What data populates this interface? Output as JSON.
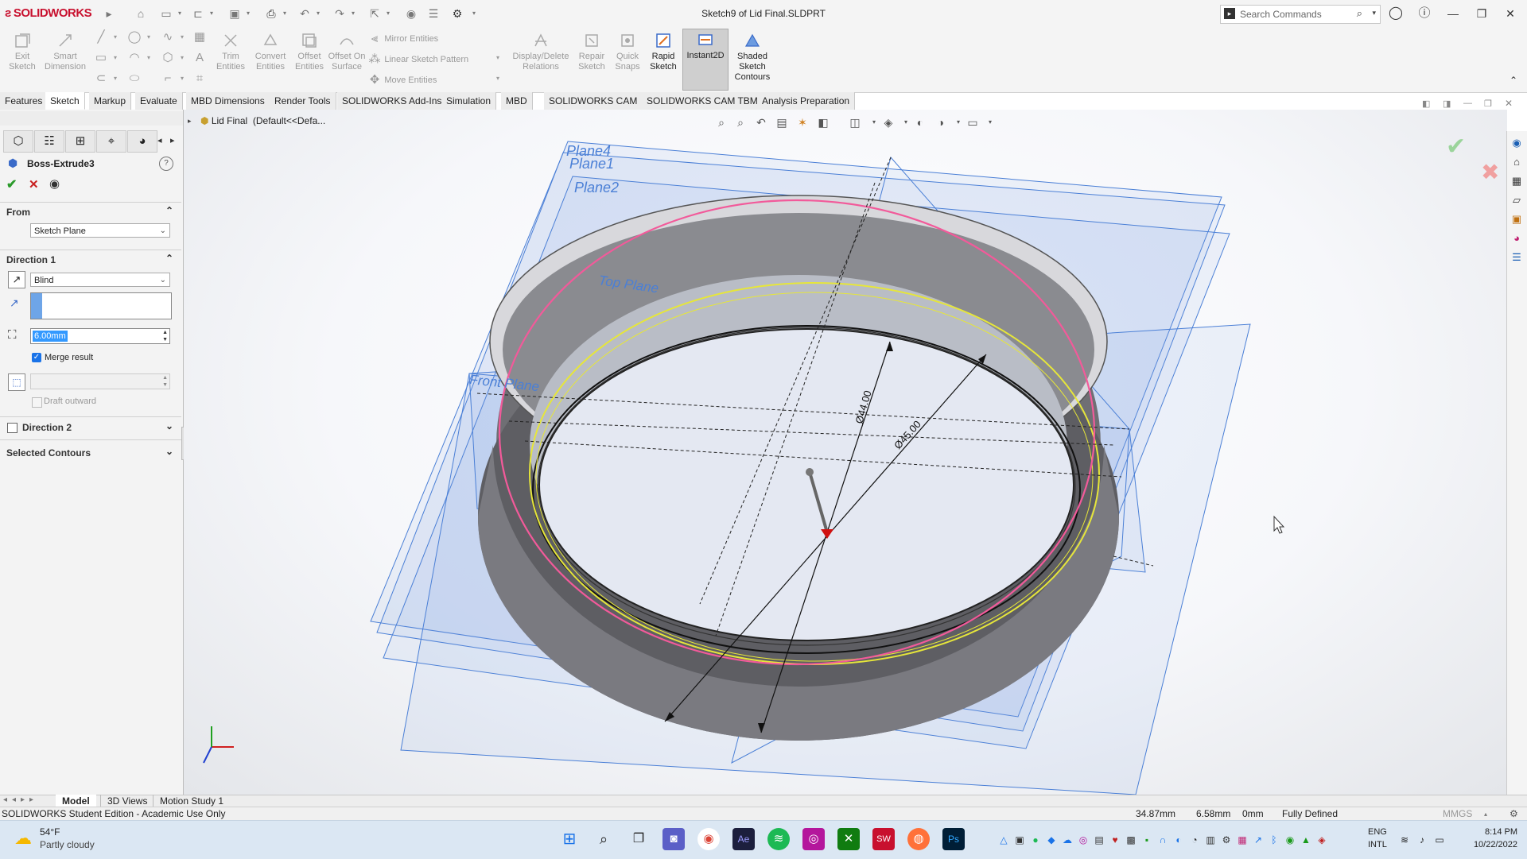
{
  "app": {
    "brand": "SOLIDWORKS",
    "document_title": "Sketch9 of Lid Final.SLDPRT"
  },
  "search": {
    "placeholder": "Search Commands"
  },
  "commands": {
    "exit_sketch": "Exit Sketch",
    "smart_dimension": "Smart Dimension",
    "trim_entities": "Trim Entities",
    "convert_entities": "Convert Entities",
    "offset_entities": "Offset Entities",
    "offset_on_surface": "Offset On Surface",
    "mirror_entities": "Mirror Entities",
    "linear_sketch_pattern": "Linear Sketch Pattern",
    "move_entities": "Move Entities",
    "display_delete_relations": "Display/Delete Relations",
    "repair_sketch": "Repair Sketch",
    "quick_snaps": "Quick Snaps",
    "rapid_sketch": "Rapid Sketch",
    "instant2d": "Instant2D",
    "shaded_sketch_contours": "Shaded Sketch Contours"
  },
  "tabs": [
    "Features",
    "Sketch",
    "Markup",
    "Evaluate",
    "MBD Dimensions",
    "Render Tools",
    "SOLIDWORKS Add-Ins",
    "Simulation",
    "MBD",
    "SOLIDWORKS CAM",
    "SOLIDWORKS CAM TBM",
    "Analysis Preparation"
  ],
  "active_tab": "Sketch",
  "feature_tree": {
    "part": "Lid Final",
    "config": "(Default<<Defa..."
  },
  "property_manager": {
    "feature_title": "Boss-Extrude3",
    "from": {
      "heading": "From",
      "value": "Sketch Plane"
    },
    "direction1": {
      "heading": "Direction 1",
      "end_condition": "Blind",
      "depth": "6.00mm",
      "merge_result_label": "Merge result",
      "merge_result_checked": true,
      "draft_outward_label": "Draft outward"
    },
    "direction2": {
      "heading": "Direction 2"
    },
    "selected_contours": {
      "heading": "Selected Contours"
    }
  },
  "viewport": {
    "planes": [
      "Plane4",
      "Plane1",
      "Plane2",
      "Top Plane",
      "Front Plane"
    ],
    "dimensions": [
      "Ø44.00",
      "Ø45.00"
    ]
  },
  "bottom_tabs": [
    "Model",
    "3D Views",
    "Motion Study 1"
  ],
  "active_bottom_tab": "Model",
  "status": {
    "edition": "SOLIDWORKS Student Edition - Academic Use Only",
    "x": "34.87mm",
    "y": "6.58mm",
    "z": "0mm",
    "state": "Fully Defined",
    "units": "MMGS"
  },
  "taskbar": {
    "weather_temp": "54°F",
    "weather_desc": "Partly cloudy",
    "lang1": "ENG",
    "lang2": "INTL",
    "time": "8:14 PM",
    "date": "10/22/2022"
  },
  "colors": {
    "accent_red": "#c8102e",
    "plane_blue": "#4a7fd6",
    "sketch_pink": "#f25a9a",
    "sketch_yellow": "#e6e63a"
  }
}
